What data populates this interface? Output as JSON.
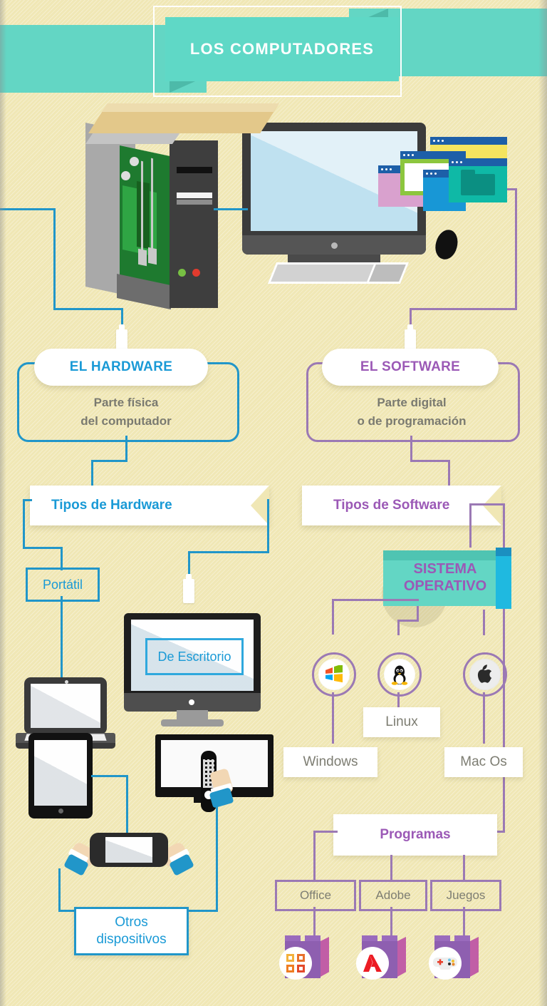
{
  "header": {
    "title": "LOS COMPUTADORES"
  },
  "colors": {
    "background": "#f0e7b5",
    "teal": "#63d6c4",
    "blue_accent": "#2196c9",
    "purple_accent": "#9b79b4",
    "purple_text": "#9b59b6",
    "gray_text": "#7a7a70",
    "white": "#ffffff"
  },
  "hardware": {
    "pill_label": "EL HARDWARE",
    "description_line1": "Parte física",
    "description_line2": "del computador",
    "types_banner": "Tipos de Hardware",
    "items": {
      "portatil": "Portátil",
      "escritorio": "De Escritorio",
      "otros_line1": "Otros",
      "otros_line2": "dispositivos"
    }
  },
  "software": {
    "pill_label": "EL SOFTWARE",
    "description_line1": "Parte digital",
    "description_line2": "o de programación",
    "types_banner": "Tipos de Software",
    "operating_system": {
      "title_line1": "SISTEMA",
      "title_line2": "OPERATIVO",
      "systems": [
        {
          "label": "Windows",
          "icon": "windows-logo-icon"
        },
        {
          "label": "Linux",
          "icon": "linux-penguin-icon"
        },
        {
          "label": "Mac Os",
          "icon": "apple-logo-icon"
        }
      ]
    },
    "programs": {
      "title": "Programas",
      "items": [
        {
          "label": "Office",
          "icon": "microsoft-office-icon"
        },
        {
          "label": "Adobe",
          "icon": "adobe-logo-icon"
        },
        {
          "label": "Juegos",
          "icon": "gamepad-icon"
        }
      ]
    }
  },
  "illustration": {
    "tower": "computer-tower-icon",
    "monitor": "desktop-monitor-icon",
    "keyboard": "keyboard-icon",
    "mouse": "mouse-icon",
    "floating_windows": "application-windows-icon",
    "laptop": "laptop-icon",
    "tablet": "tablet-icon",
    "television": "television-icon",
    "remote": "remote-control-icon",
    "handheld": "handheld-console-icon"
  }
}
